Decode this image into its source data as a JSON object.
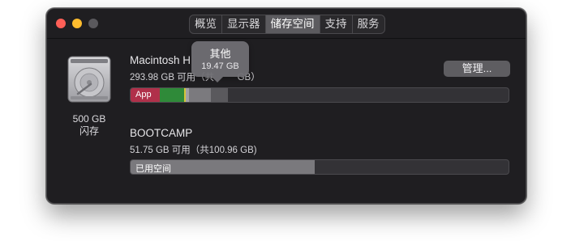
{
  "window": {
    "tabs": [
      {
        "label": "概览"
      },
      {
        "label": "显示器"
      },
      {
        "label": "储存空间"
      },
      {
        "label": "支持"
      },
      {
        "label": "服务"
      }
    ],
    "active_tab": "储存空间"
  },
  "disk": {
    "capacity": "500 GB",
    "type": "闪存"
  },
  "volumes": [
    {
      "name": "Macintosh H",
      "available": "293.98 GB 可用",
      "available_tail": "（共 ",
      "available_tail2": " GB）",
      "segments": [
        {
          "label": "App",
          "color": "#b0304a",
          "fraction": 0.078
        },
        {
          "label": "",
          "color": "#2f8a39",
          "fraction": 0.064
        },
        {
          "label": "",
          "color": "#d5c53a",
          "fraction": 0.004
        },
        {
          "label": "",
          "color": "#a2a1a5",
          "fraction": 0.008
        },
        {
          "label": "",
          "color": "#7b7a7e",
          "fraction": 0.059
        },
        {
          "label": "",
          "color": "#5a595d",
          "fraction": 0.044
        }
      ]
    },
    {
      "name": "BOOTCAMP",
      "available": "51.75 GB 可用（共100.96 GB)",
      "segments": [
        {
          "label": "已用空间",
          "color": "#7a797d",
          "fraction": 0.487
        }
      ]
    }
  ],
  "manage_button": {
    "label": "管理..."
  },
  "tooltip": {
    "title": "其他",
    "size": "19.47 GB"
  }
}
